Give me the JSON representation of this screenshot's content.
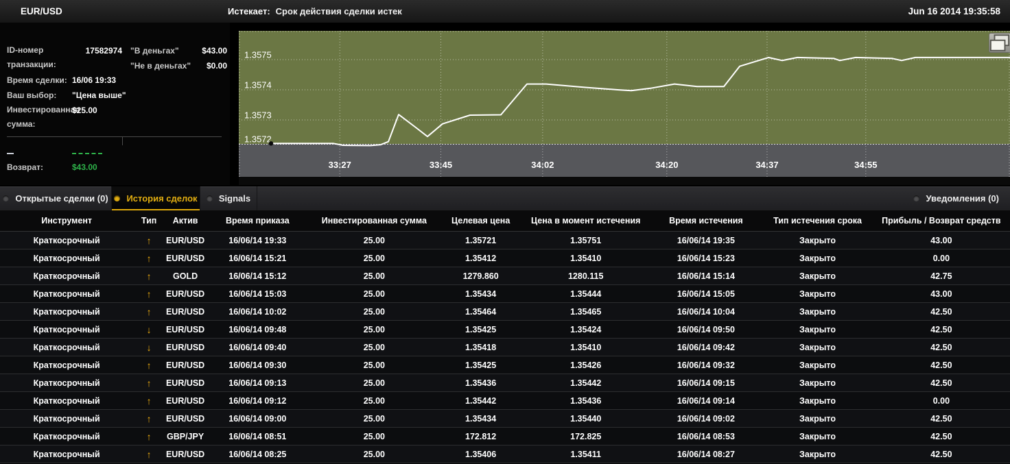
{
  "top_bar": {
    "symbol": "EUR/USD",
    "status_label": "Истекает:",
    "status_text": "Срок действия сделки истек",
    "datetime": "Jun 16 2014  19:35:58"
  },
  "trade_panel": {
    "id_label": "ID-номер транзакции:",
    "id_value": "17582974",
    "in_money_label": "\"В деньгах\"",
    "in_money_value": "$43.00",
    "out_money_label": "\"Не в деньгах\"",
    "out_money_value": "$0.00",
    "time_label": "Время сделки:",
    "time_value": "16/06 19:33",
    "choice_label": "Ваш выбор:",
    "choice_value": "\"Цена выше\"",
    "invest_label": "Инвестированная сумма:",
    "invest_value": "$25.00",
    "dash": "–",
    "return_label": "Возврат:",
    "return_value": "$43.00"
  },
  "chart_data": {
    "type": "line",
    "symbol": "EUR/USD",
    "plot_bg": "#6b7744",
    "below_bg": "#56575b",
    "grid": true,
    "y_ticks": [
      1.3575,
      1.3574,
      1.3573,
      1.3572
    ],
    "y_range": [
      1.35712,
      1.35758
    ],
    "x_ticks": [
      {
        "label": "33:27",
        "pos": 0.131
      },
      {
        "label": "33:45",
        "pos": 0.262
      },
      {
        "label": "34:02",
        "pos": 0.394
      },
      {
        "label": "34:20",
        "pos": 0.555
      },
      {
        "label": "34:37",
        "pos": 0.685
      },
      {
        "label": "34:55",
        "pos": 0.813
      }
    ],
    "series": [
      {
        "name": "EUR/USD price",
        "color": "#ffffff",
        "points": [
          [
            47,
            1.357222
          ],
          [
            138,
            1.357222
          ],
          [
            152,
            1.357216
          ],
          [
            192,
            1.357215
          ],
          [
            207,
            1.357218
          ],
          [
            218,
            1.357228
          ],
          [
            233,
            1.357318
          ],
          [
            258,
            1.357275
          ],
          [
            275,
            1.357245
          ],
          [
            297,
            1.357287
          ],
          [
            337,
            1.357316
          ],
          [
            382,
            1.357317
          ],
          [
            420,
            1.357419
          ],
          [
            448,
            1.357419
          ],
          [
            505,
            1.357408
          ],
          [
            552,
            1.3574
          ],
          [
            572,
            1.357397
          ],
          [
            600,
            1.357405
          ],
          [
            635,
            1.357419
          ],
          [
            668,
            1.357411
          ],
          [
            707,
            1.357411
          ],
          [
            730,
            1.357478
          ],
          [
            772,
            1.357507
          ],
          [
            792,
            1.357497
          ],
          [
            814,
            1.357507
          ],
          [
            867,
            1.357504
          ],
          [
            876,
            1.357497
          ],
          [
            899,
            1.357507
          ],
          [
            952,
            1.357504
          ],
          [
            966,
            1.357497
          ],
          [
            986,
            1.357507
          ],
          [
            1124,
            1.357507
          ]
        ]
      }
    ]
  },
  "tabs": [
    {
      "label": "Открытые сделки (0)",
      "active": false
    },
    {
      "label": "История сделок",
      "active": true
    },
    {
      "label": "Signals",
      "active": false
    }
  ],
  "notifications": {
    "label": "Уведомления (0)"
  },
  "table": {
    "columns": [
      "Инструмент",
      "Тип",
      "Актив",
      "Время приказа",
      "Инвестированная сумма",
      "Целевая цена",
      "Цена в момент истечения",
      "Время истечения",
      "Тип истечения срока",
      "Прибыль / Возврат средств"
    ],
    "rows": [
      [
        "Краткосрочный",
        "up",
        "EUR/USD",
        "16/06/14 19:33",
        "25.00",
        "1.35721",
        "1.35751",
        "16/06/14 19:35",
        "Закрыто",
        "43.00"
      ],
      [
        "Краткосрочный",
        "up",
        "EUR/USD",
        "16/06/14 15:21",
        "25.00",
        "1.35412",
        "1.35410",
        "16/06/14 15:23",
        "Закрыто",
        "0.00"
      ],
      [
        "Краткосрочный",
        "up",
        "GOLD",
        "16/06/14 15:12",
        "25.00",
        "1279.860",
        "1280.115",
        "16/06/14 15:14",
        "Закрыто",
        "42.75"
      ],
      [
        "Краткосрочный",
        "up",
        "EUR/USD",
        "16/06/14 15:03",
        "25.00",
        "1.35434",
        "1.35444",
        "16/06/14 15:05",
        "Закрыто",
        "43.00"
      ],
      [
        "Краткосрочный",
        "up",
        "EUR/USD",
        "16/06/14 10:02",
        "25.00",
        "1.35464",
        "1.35465",
        "16/06/14 10:04",
        "Закрыто",
        "42.50"
      ],
      [
        "Краткосрочный",
        "down",
        "EUR/USD",
        "16/06/14 09:48",
        "25.00",
        "1.35425",
        "1.35424",
        "16/06/14 09:50",
        "Закрыто",
        "42.50"
      ],
      [
        "Краткосрочный",
        "down",
        "EUR/USD",
        "16/06/14 09:40",
        "25.00",
        "1.35418",
        "1.35410",
        "16/06/14 09:42",
        "Закрыто",
        "42.50"
      ],
      [
        "Краткосрочный",
        "up",
        "EUR/USD",
        "16/06/14 09:30",
        "25.00",
        "1.35425",
        "1.35426",
        "16/06/14 09:32",
        "Закрыто",
        "42.50"
      ],
      [
        "Краткосрочный",
        "up",
        "EUR/USD",
        "16/06/14 09:13",
        "25.00",
        "1.35436",
        "1.35442",
        "16/06/14 09:15",
        "Закрыто",
        "42.50"
      ],
      [
        "Краткосрочный",
        "up",
        "EUR/USD",
        "16/06/14 09:12",
        "25.00",
        "1.35442",
        "1.35436",
        "16/06/14 09:14",
        "Закрыто",
        "0.00"
      ],
      [
        "Краткосрочный",
        "up",
        "EUR/USD",
        "16/06/14 09:00",
        "25.00",
        "1.35434",
        "1.35440",
        "16/06/14 09:02",
        "Закрыто",
        "42.50"
      ],
      [
        "Краткосрочный",
        "up",
        "GBP/JPY",
        "16/06/14 08:51",
        "25.00",
        "172.812",
        "172.825",
        "16/06/14 08:53",
        "Закрыто",
        "42.50"
      ],
      [
        "Краткосрочный",
        "up",
        "EUR/USD",
        "16/06/14 08:25",
        "25.00",
        "1.35406",
        "1.35411",
        "16/06/14 08:27",
        "Закрыто",
        "42.50"
      ]
    ]
  },
  "colors": {
    "accent_yellow": "#e2ae11",
    "profit_green": "#2eb34a",
    "arrow_yellow": "#f2b010",
    "price_line": "#ffffff",
    "chart_plot_bg": "#6b7744",
    "chart_below_bg": "#56575b"
  }
}
